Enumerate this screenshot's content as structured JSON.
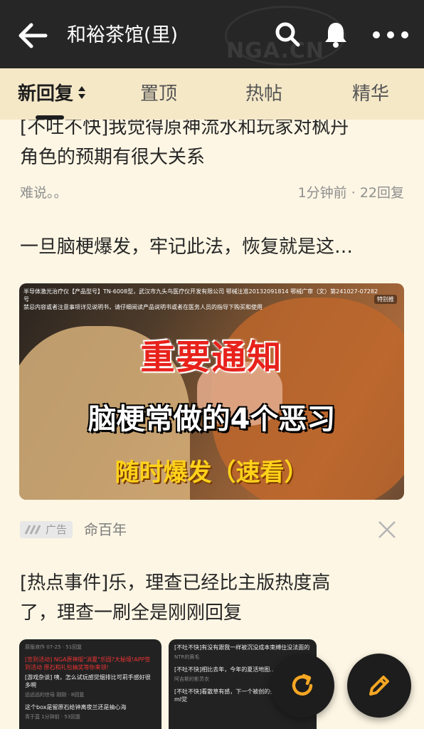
{
  "header": {
    "title": "和裕茶馆(里)",
    "back_icon": "arrow-left-icon",
    "icons": [
      "search-icon",
      "bell-icon",
      "more-icon"
    ],
    "watermark": "NGA.CN"
  },
  "tabs": [
    {
      "label": "新回复",
      "active": true
    },
    {
      "label": "置顶",
      "active": false
    },
    {
      "label": "热帖",
      "active": false
    },
    {
      "label": "精华",
      "active": false
    }
  ],
  "posts": [
    {
      "title_line1": "[不吐不快]我觉得原神流水和玩家对枫丹",
      "title_line2": "角色的预期有很大关系",
      "author": "难说。。",
      "time": "1分钟前",
      "replies": "22回复"
    }
  ],
  "ad": {
    "title": "一旦脑梗爆发，牢记此法，恢复就是这…",
    "fine_print_1": "半导体激光治疗仪【产品型号】TN-6008型，武汉市九头鸟医疗仪开发有限公司 鄂械注准20132091814  鄂械广审（文）第241027-07282号",
    "fine_print_2": "禁忌内容或者注意事项详见说明书，请仔细阅读产品说明书或者在医务人员的指导下购买和使用",
    "corner_tag": "特别推",
    "headline": "重要通知",
    "subheadline": "脑梗常做的4个恶习",
    "tagline": "随时爆发（速看）",
    "badge": "广告",
    "source": "命百年"
  },
  "post2": {
    "title_line1": "[热点事件]乐，理查已经比主版热度高",
    "title_line2": "了，理查一刷全是刚刚回复"
  },
  "thumb_left": [
    {
      "text": "原版液作              07-25 · 51回复",
      "style": "sub"
    },
    {
      "text": "[签到活动] NGA原神版\"消夏\"乐园?大秘境!APP签到活动 原石和礼包抽奖等你来领!",
      "style": "red"
    },
    {
      "text": "[游戏杂谈] 咦，怎么试玩感觉烟排比可莉手感好很多啊",
      "style": ""
    },
    {
      "text": "远远远的世母                    刚刚 · 8回复",
      "style": "sub"
    },
    {
      "text": "这个box是留原石给钟离夜兰还是抽心海",
      "style": ""
    },
    {
      "text": "青于蓝                    1分钟前 · 53回复",
      "style": "sub"
    }
  ],
  "thumb_right": [
    {
      "text": "[不吐不快]有没有跟我一样被沉没成本束缚住没法面的",
      "style": ""
    },
    {
      "text": "NTR的黄毛",
      "style": "sub"
    },
    {
      "text": "[不吐不快]相比去年，今年的夏活地图……",
      "style": ""
    },
    {
      "text": "阿吉斯的影灵衣",
      "style": "sub"
    },
    {
      "text": "[不吐不快]看散草有感，下一个被创的会不会是贝多ml党",
      "style": ""
    }
  ],
  "fabs": {
    "refresh_icon": "refresh-icon",
    "compose_icon": "pencil-icon",
    "accent": "#f5a623"
  },
  "colors": {
    "header_bg": "#262626",
    "tabs_bg": "#f5e8c7",
    "page_bg": "#fdf6e4",
    "meta": "#8f8f8f"
  }
}
